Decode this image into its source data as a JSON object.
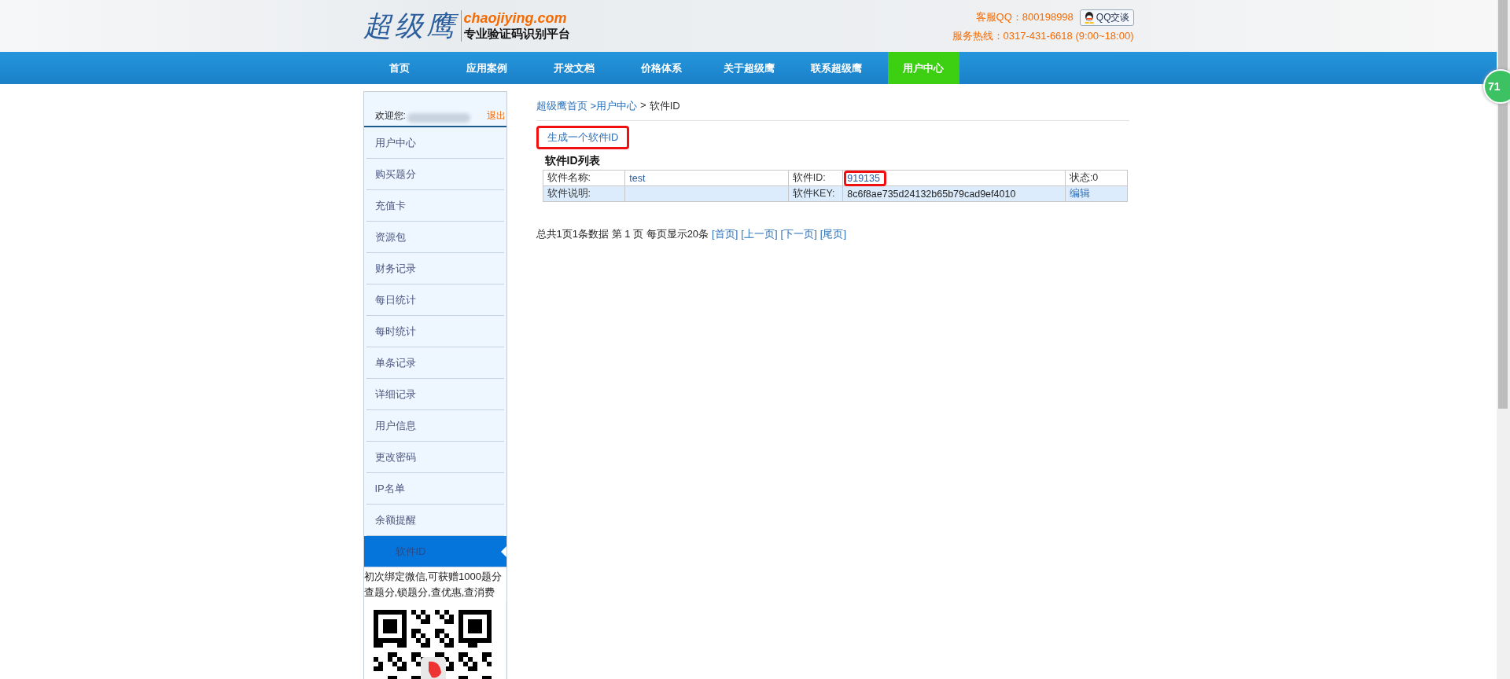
{
  "header": {
    "logo_script": "超级鹰",
    "domain": "chaojiying.com",
    "slogan": "专业验证码识别平台",
    "qq_label": "客服QQ：800198998",
    "qq_button": "QQ交谈",
    "hotline": "服务热线：0317-431-6618 (9:00~18:00)"
  },
  "nav": [
    {
      "label": "首页",
      "selected": false
    },
    {
      "label": "应用案例",
      "selected": false
    },
    {
      "label": "开发文档",
      "selected": false
    },
    {
      "label": "价格体系",
      "selected": false
    },
    {
      "label": "关于超级鹰",
      "selected": false
    },
    {
      "label": "联系超级鹰",
      "selected": false
    },
    {
      "label": "用户中心",
      "selected": true
    }
  ],
  "sidebar": {
    "welcome": "欢迎您:",
    "username_redacted": true,
    "logout": "退出",
    "items": [
      {
        "label": "用户中心",
        "selected": false
      },
      {
        "label": "购买题分",
        "selected": false
      },
      {
        "label": "充值卡",
        "selected": false
      },
      {
        "label": "资源包",
        "selected": false
      },
      {
        "label": "财务记录",
        "selected": false
      },
      {
        "label": "每日统计",
        "selected": false
      },
      {
        "label": "每时统计",
        "selected": false
      },
      {
        "label": "单条记录",
        "selected": false
      },
      {
        "label": "详细记录",
        "selected": false
      },
      {
        "label": "用户信息",
        "selected": false
      },
      {
        "label": "更改密码",
        "selected": false
      },
      {
        "label": "IP名单",
        "selected": false
      },
      {
        "label": "余额提醒",
        "selected": false
      },
      {
        "label": "软件ID",
        "selected": true
      }
    ],
    "promo": "初次绑定微信,可获赠1000题分查题分,锁题分,查优惠,查消费"
  },
  "breadcrumb": [
    "超级鹰首页",
    ">用户中心",
    ">",
    "软件ID"
  ],
  "generate_link": {
    "label": "生成一个软件ID",
    "annotated": true
  },
  "list_title": "软件ID列表",
  "table": {
    "rows": [
      {
        "cells": [
          {
            "kind": "label",
            "text": "软件名称:"
          },
          {
            "kind": "value",
            "text": "test"
          },
          {
            "kind": "label",
            "text": "软件ID:"
          },
          {
            "kind": "value",
            "text": "919135",
            "annotated": true
          },
          {
            "kind": "label",
            "text": "状态:0"
          }
        ]
      },
      {
        "cells": [
          {
            "kind": "label",
            "text": "软件说明:"
          },
          {
            "kind": "value",
            "text": ""
          },
          {
            "kind": "label",
            "text": "软件KEY:"
          },
          {
            "kind": "plain",
            "text": "8c6f8ae735d24132b65b79cad9ef4010"
          },
          {
            "kind": "link",
            "text": "编辑"
          }
        ]
      }
    ]
  },
  "pagination": {
    "summary": "总共1页1条数据 第 1 页 每页显示20条",
    "links": [
      "[首页]",
      "[上一页]",
      "[下一页]",
      "[尾页]"
    ]
  },
  "badge": "71"
}
